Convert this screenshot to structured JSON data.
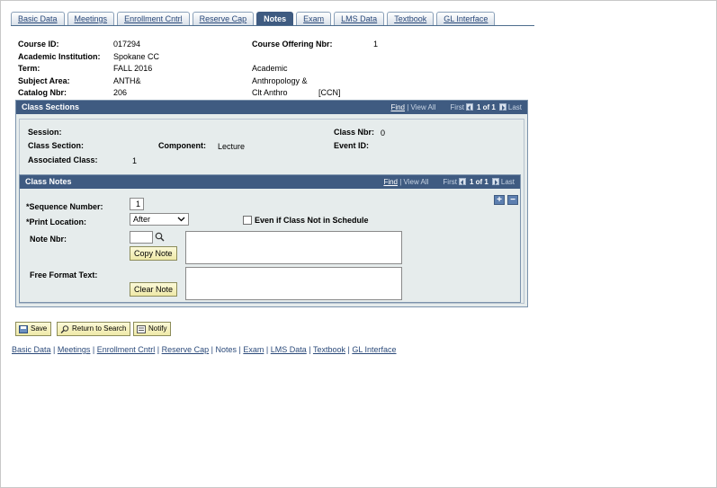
{
  "tabs": [
    {
      "label": "Basic Data"
    },
    {
      "label": "Meetings"
    },
    {
      "label": "Enrollment Cntrl"
    },
    {
      "label": "Reserve Cap"
    },
    {
      "label": "Notes",
      "active": true
    },
    {
      "label": "Exam"
    },
    {
      "label": "LMS Data"
    },
    {
      "label": "Textbook"
    },
    {
      "label": "GL Interface"
    }
  ],
  "header": {
    "course_id_label": "Course ID:",
    "course_id": "017294",
    "offering_label": "Course Offering Nbr:",
    "offering": "1",
    "institution_label": "Academic Institution:",
    "institution": "Spokane CC",
    "term_label": "Term:",
    "term": "FALL 2016",
    "term_desc": "Academic",
    "subject_label": "Subject Area:",
    "subject": "ANTH&",
    "subject_desc": "Anthropology &",
    "catalog_label": "Catalog Nbr:",
    "catalog": "206",
    "catalog_desc": "Clt Anthro",
    "catalog_code": "[CCN]"
  },
  "class_sections": {
    "title": "Class Sections",
    "nav": {
      "find": "Find",
      "view_all": "View All",
      "first": "First",
      "count": "1 of 1",
      "last": "Last"
    },
    "session_label": "Session:",
    "class_nbr_label": "Class Nbr:",
    "class_nbr": "0",
    "class_section_label": "Class Section:",
    "component_label": "Component:",
    "component": "Lecture",
    "event_id_label": "Event ID:",
    "assoc_class_label": "Associated Class:",
    "assoc_class": "1"
  },
  "class_notes": {
    "title": "Class Notes",
    "nav": {
      "find": "Find",
      "view_all": "View All",
      "first": "First",
      "count": "1 of 1",
      "last": "Last"
    },
    "seq_label": "*Sequence Number:",
    "seq_value": "1",
    "print_loc_label": "*Print Location:",
    "print_loc_value": "After",
    "even_if_label": "Even if Class Not in Schedule",
    "note_nbr_label": "Note Nbr:",
    "copy_note": "Copy Note",
    "free_format_label": "Free Format Text:",
    "clear_note": "Clear Note",
    "add": "+",
    "remove": "−"
  },
  "toolbar": {
    "save": "Save",
    "return": "Return to Search",
    "notify": "Notify"
  },
  "footer": [
    "Basic Data",
    "Meetings",
    "Enrollment Cntrl",
    "Reserve Cap",
    "Notes",
    "Exam",
    "LMS Data",
    "Textbook",
    "GL Interface"
  ]
}
